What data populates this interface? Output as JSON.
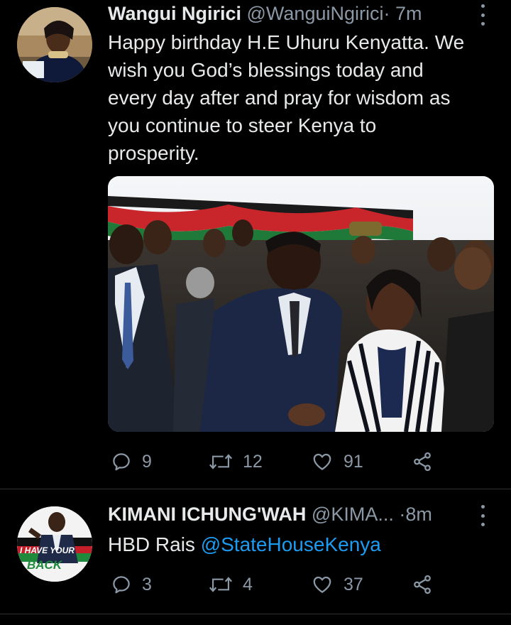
{
  "tweets": [
    {
      "display_name": "Wangui Ngirici",
      "handle": "@WanguiNgirici",
      "separator": "·",
      "time": "7m",
      "text": "Happy birthday H.E Uhuru Kenyatta. We wish you God’s blessings today and every day after and pray for wisdom as you continue to steer Kenya to prosperity.",
      "text_lines": [
        "Happy birthday H.E Uhuru Kenyatta. We",
        "wish you God’s blessings today and",
        "every day after and pray for wisdom as",
        "you continue to steer Kenya to",
        "prosperity."
      ],
      "has_photo": true,
      "replies": "9",
      "retweets": "12",
      "likes": "91"
    },
    {
      "display_name": "KIMANI ICHUNG'WAH",
      "handle": "@KIMA...",
      "separator": "·",
      "time": "8m",
      "text_prefix": "HBD Rais ",
      "mention": "@StateHouseKenya",
      "avatar_text_line1": "I HAVE YOUR",
      "avatar_text_line2": "BACK",
      "replies": "3",
      "retweets": "4",
      "likes": "37"
    }
  ],
  "icons": {
    "reply": "reply-icon",
    "retweet": "retweet-icon",
    "like": "heart-icon",
    "share": "share-icon",
    "more": "more-icon"
  },
  "colors": {
    "background": "#000000",
    "text": "#e7e9ea",
    "muted": "#8b98a5",
    "link": "#1d9bf0",
    "divider": "#2f3336"
  }
}
